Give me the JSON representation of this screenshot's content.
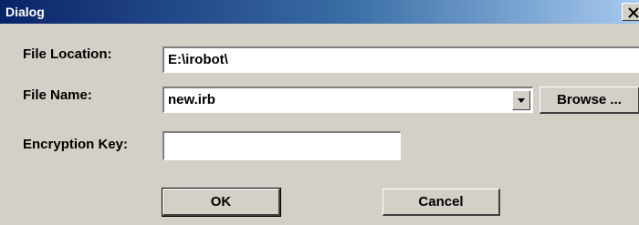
{
  "window": {
    "title": "Dialog",
    "close_glyph": "X",
    "close_icon": "close-icon"
  },
  "form": {
    "file_location": {
      "label": "File Location:",
      "value": "E:\\irobot\\"
    },
    "file_name": {
      "label": "File Name:",
      "value": "new.irb",
      "dropdown_icon": "chevron-down-icon"
    },
    "encryption_key": {
      "label": "Encryption Key:",
      "value": ""
    }
  },
  "buttons": {
    "browse_label": "Browse ...",
    "ok_label": "OK",
    "cancel_label": "Cancel"
  },
  "colors": {
    "face": "#d4d0c8",
    "title_gradient_start": "#0a246a",
    "title_gradient_end": "#a6caf0",
    "field_bg": "#ffffff"
  }
}
